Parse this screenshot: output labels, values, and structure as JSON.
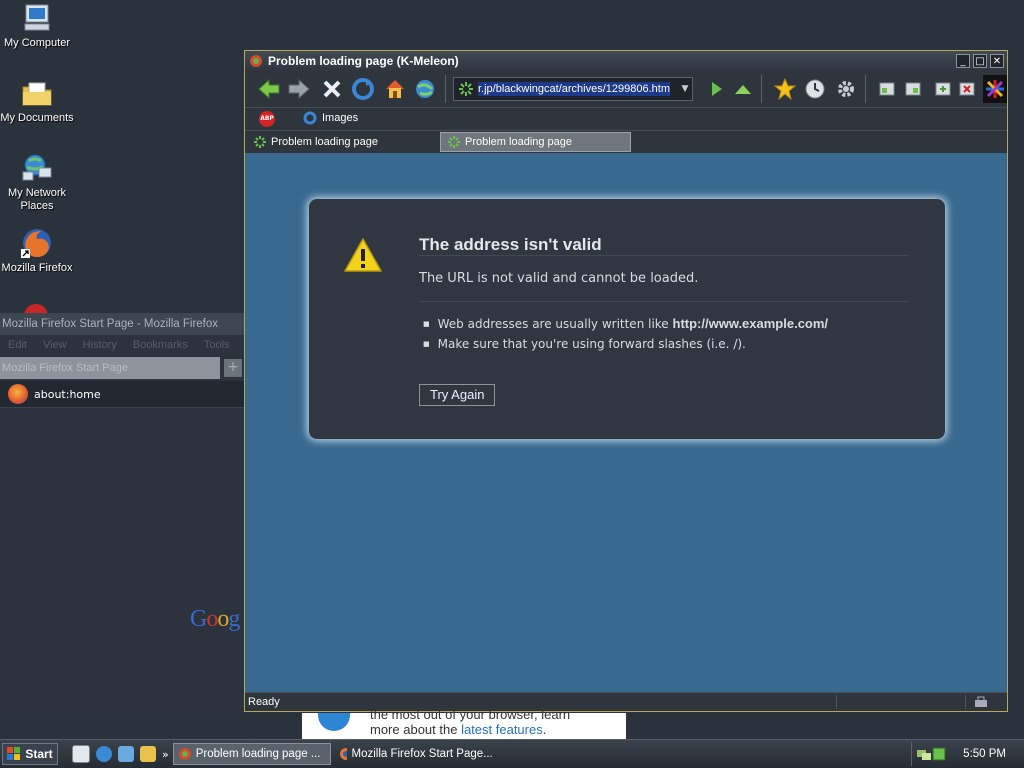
{
  "desktop": {
    "icons": [
      {
        "label": "My Computer"
      },
      {
        "label": "My Documents"
      },
      {
        "label": "My Network Places"
      },
      {
        "label": "Mozilla Firefox"
      }
    ]
  },
  "firefox_window": {
    "title": "Mozilla Firefox Start Page - Mozilla Firefox",
    "menu": [
      "Edit",
      "View",
      "History",
      "Bookmarks",
      "Tools"
    ],
    "tab_label": "Mozilla Firefox Start Page",
    "url": "about:home",
    "google_text": "Goog"
  },
  "kmeleon": {
    "title": "Problem loading page (K-Meleon)",
    "url": "r.jp/blackwingcat/archives/1299806.html",
    "bar2": {
      "abp_label": "ABP",
      "images_label": "Images"
    },
    "tabs": [
      {
        "label": "Problem loading page"
      },
      {
        "label": "Problem loading page"
      }
    ],
    "status": "Ready"
  },
  "error": {
    "title": "The address isn't valid",
    "description": "The URL is not valid and cannot be loaded.",
    "bullet1_prefix": "Web addresses are usually written like ",
    "bullet1_example": "http://www.example.com/",
    "bullet2": "Make sure that you're using forward slashes (i.e. /).",
    "button": "Try Again"
  },
  "ad": {
    "line1": "the most out of your browser, learn",
    "line2_prefix": "more about the ",
    "line2_link": "latest features",
    "line2_suffix": "."
  },
  "taskbar": {
    "start": "Start",
    "chevron": "»",
    "tasks": [
      {
        "label": "Problem loading page ..."
      },
      {
        "label": "Mozilla Firefox Start Page..."
      }
    ],
    "clock": "5:50 PM"
  },
  "colors": {
    "content_bg": "#39698f",
    "error_box_bg": "#303740",
    "window_border": "#b6a660",
    "url_selection": "#1d3a8a"
  }
}
